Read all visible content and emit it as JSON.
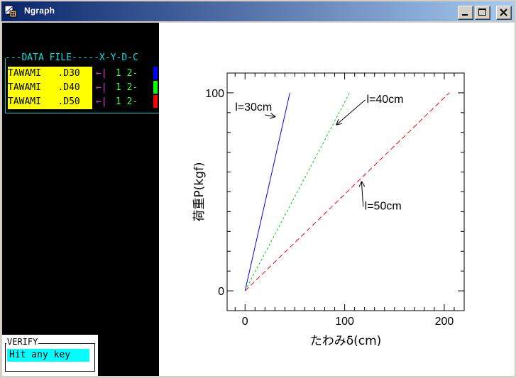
{
  "window": {
    "title": "Ngraph"
  },
  "icons": {
    "app": "ngraph-app-icon",
    "minimize": "minimize-icon",
    "maximize": "maximize-icon",
    "close": "close-icon"
  },
  "file_panel": {
    "header": "---DATA FILE-----X-Y-D-C",
    "files": [
      {
        "name": "TAWAMI   .D30",
        "marker": "←|",
        "columns": "1 2-",
        "color": "#0000ff"
      },
      {
        "name": "TAWAMI   .D40",
        "marker": "←|",
        "columns": "1 2-",
        "color": "#00ff00"
      },
      {
        "name": "TAWAMI   .D50",
        "marker": "←|",
        "columns": "1 2-",
        "color": "#ff0000"
      }
    ]
  },
  "verify": {
    "label": "VERIFY",
    "message": "Hit any key"
  },
  "chart_data": {
    "type": "line",
    "xlabel": "たわみδ(cm)",
    "ylabel": "荷重P(kgf)",
    "xlim": [
      -18,
      220
    ],
    "ylim": [
      -10,
      110
    ],
    "x_ticks": [
      0,
      100,
      200
    ],
    "y_ticks": [
      0,
      100
    ],
    "series": [
      {
        "name": "l=30cm",
        "color": "#0000ff",
        "dash": "solid",
        "x": [
          0,
          45
        ],
        "y": [
          0,
          100
        ]
      },
      {
        "name": "l=40cm",
        "color": "#00cc00",
        "dash": "dashed",
        "x": [
          0,
          105
        ],
        "y": [
          0,
          100
        ]
      },
      {
        "name": "l=50cm",
        "color": "#ff0000",
        "dash": "dashed",
        "x": [
          0,
          205
        ],
        "y": [
          0,
          100
        ]
      }
    ],
    "annotations": [
      {
        "text": "l=30cm",
        "x": 30,
        "y": 88,
        "text_x": -10,
        "text_y": 91
      },
      {
        "text": "l=40cm",
        "x": 92,
        "y": 84,
        "text_x": 122,
        "text_y": 95
      },
      {
        "text": "l=50cm",
        "x": 117,
        "y": 55,
        "text_x": 120,
        "text_y": 41
      }
    ]
  }
}
